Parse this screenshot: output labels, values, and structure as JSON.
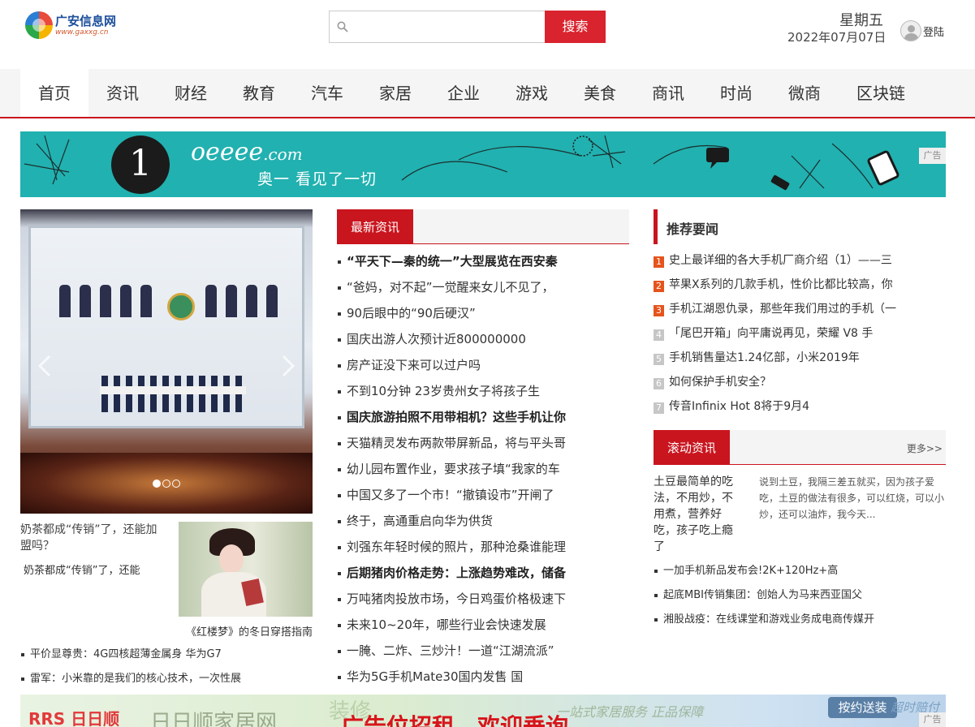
{
  "header": {
    "logo_name": "广安信息网",
    "logo_url": "www.gaxxg.cn",
    "search_placeholder": "",
    "search_button": "搜索",
    "weekday": "星期五",
    "date": "2022年07月07日",
    "login": "登陆"
  },
  "nav": {
    "items": [
      {
        "label": "首页",
        "active": true
      },
      {
        "label": "资讯"
      },
      {
        "label": "财经"
      },
      {
        "label": "教育"
      },
      {
        "label": "汽车"
      },
      {
        "label": "家居"
      },
      {
        "label": "企业"
      },
      {
        "label": "游戏"
      },
      {
        "label": "美食"
      },
      {
        "label": "商讯"
      },
      {
        "label": "时尚"
      },
      {
        "label": "微商"
      },
      {
        "label": "区块链"
      }
    ]
  },
  "banner_ad": {
    "number": "1",
    "brand": "oeeee",
    "brand_suffix": ".com",
    "slogan": "奥一 看见了一切",
    "tag": "广告",
    "color": "#21b1b0"
  },
  "carousel": {
    "prev_icon": "chevron-left-icon",
    "next_icon": "chevron-right-icon",
    "slide_count": 3,
    "active_slide": 1
  },
  "feature": {
    "alt_text": "奶茶都成“传销”了，还能加盟吗？",
    "caption": "奶茶都成“传销”了，还能",
    "image_caption": "《红楼梦》的冬日穿搭指南"
  },
  "left_list": [
    "平价显尊贵：4G四核超薄金属身 华为G7",
    "雷军：小米靠的是我们的核心技术，一次性展"
  ],
  "news": {
    "tab": "最新资讯",
    "items": [
      {
        "text": "“平天下—秦的统一”大型展览在西安秦",
        "bold": true
      },
      {
        "text": "“爸妈，对不起”一觉醒来女儿不见了，",
        "bold": false
      },
      {
        "text": "90后眼中的“90后硬汉”",
        "bold": false
      },
      {
        "text": "国庆出游人次预计近800000000",
        "bold": false
      },
      {
        "text": "房产证没下来可以过户吗",
        "bold": false
      },
      {
        "text": "不到10分钟 23岁贵州女子将孩子生",
        "bold": false
      },
      {
        "text": "国庆旅游拍照不用带相机？这些手机让你",
        "bold": true
      },
      {
        "text": "天猫精灵发布两款带屏新品，将与平头哥",
        "bold": false
      },
      {
        "text": "幼儿园布置作业，要求孩子填“我家的车",
        "bold": false
      },
      {
        "text": "中国又多了一个市！“撤镇设市”开闸了",
        "bold": false
      },
      {
        "text": "终于，高通重启向华为供货",
        "bold": false
      },
      {
        "text": "刘强东年轻时候的照片，那种沧桑谁能理",
        "bold": false
      },
      {
        "text": "后期猪肉价格走势：上涨趋势难改，储备",
        "bold": true
      },
      {
        "text": "万吨猪肉投放市场，今日鸡蛋价格极速下",
        "bold": false
      },
      {
        "text": "未来10~20年，哪些行业会快速发展",
        "bold": false
      },
      {
        "text": "一腌、二炸、三炒汁！一道“江湖流派”",
        "bold": false
      },
      {
        "text": "华为5G手机Mate30国内发售 国",
        "bold": false
      }
    ]
  },
  "recommend": {
    "title": "推荐要闻",
    "items": [
      {
        "rank": "1",
        "text": "史上最详细的各大手机厂商介绍（1）——三"
      },
      {
        "rank": "2",
        "text": "苹果X系列的几款手机，性价比都比较高，你"
      },
      {
        "rank": "3",
        "text": "手机江湖恩仇录，那些年我们用过的手机（一"
      },
      {
        "rank": "4",
        "text": "「尾巴开箱」向平庸说再见，荣耀 V8 手"
      },
      {
        "rank": "5",
        "text": "手机销售量达1.24亿部，小米2019年"
      },
      {
        "rank": "6",
        "text": "如何保护手机安全？"
      },
      {
        "rank": "7",
        "text": "传音Infinix Hot 8将于9月4"
      }
    ],
    "hot_color": "#e5541c"
  },
  "rolling": {
    "tab": "滚动资讯",
    "more": "更多>>",
    "image_alt": "土豆最简单的吃法，不用炒，不用煮，营养好吃，孩子吃上瘾了",
    "description": "说到土豆，我隔三差五就买，因为孩子爱吃，土豆的做法有很多，可以红烧，可以小炒，还可以油炸，我今天...",
    "items": [
      "一加手机新品发布会!2K+120Hz+高",
      "起底MBI传销集团：创始人为马来西亚国父",
      "湘股战疫：在线课堂和游戏业务成电商传媒开"
    ]
  },
  "bottom_ad": {
    "logo": "RRS 日日顺",
    "site": "日日顺家居网",
    "faint": "装修",
    "headline": "广告位招租，欢迎垂询",
    "faint2": "一站式家居服务 正品保障",
    "badge1": "按约送装",
    "badge2": "超时赔付",
    "tag": "广告"
  },
  "colors": {
    "accent": "#c9151e",
    "search_button": "#d9232e"
  }
}
